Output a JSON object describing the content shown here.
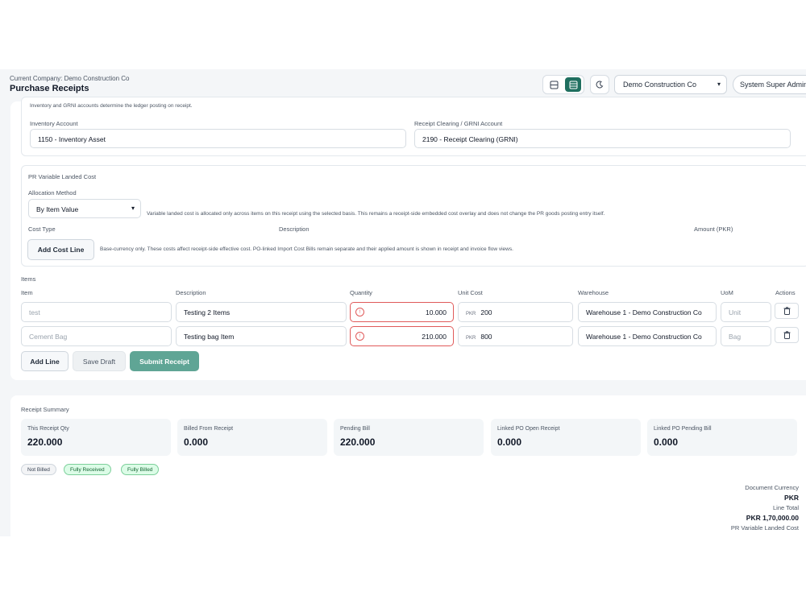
{
  "header": {
    "company_line": "Current Company: Demo Construction Co",
    "title": "Purchase Receipts",
    "company_select": "Demo Construction Co",
    "user": "System Super Admin"
  },
  "accounts": {
    "note": "Inventory and GRNI accounts determine the ledger posting on receipt.",
    "inventory_label": "Inventory Account",
    "inventory_value": "1150 - Inventory Asset",
    "grni_label": "Receipt Clearing / GRNI Account",
    "grni_value": "2190 - Receipt Clearing (GRNI)"
  },
  "landed_cost": {
    "title": "PR Variable Landed Cost",
    "allocation_label": "Allocation Method",
    "allocation_value": "By Item Value",
    "allocation_note": "Variable landed cost is allocated only across items on this receipt using the selected basis. This remains a receipt-side embedded cost overlay and does not change the PR goods posting entry itself.",
    "col_cost_type": "Cost Type",
    "col_description": "Description",
    "col_amount": "Amount (PKR)",
    "add_button": "Add Cost Line",
    "add_note": "Base-currency only. These costs affect receipt-side effective cost. PO-linked Import Cost Bills remain separate and their applied amount is shown in receipt and invoice flow views."
  },
  "items": {
    "section_label": "Items",
    "columns": {
      "item": "Item",
      "description": "Description",
      "quantity": "Quantity",
      "unit_cost": "Unit Cost",
      "warehouse": "Warehouse",
      "uom": "UoM",
      "actions": "Actions"
    },
    "currency": "PKR",
    "rows": [
      {
        "item": "test",
        "description": "Testing 2 Items",
        "quantity": "10.000",
        "unit_cost": "200",
        "warehouse": "Warehouse 1 - Demo Construction Co",
        "uom": "Unit"
      },
      {
        "item": "Cement Bag",
        "description": "Testing bag Item",
        "quantity": "210.000",
        "unit_cost": "800",
        "warehouse": "Warehouse 1 - Demo Construction Co",
        "uom": "Bag"
      }
    ],
    "add_line": "Add Line",
    "save_draft": "Save Draft",
    "submit": "Submit Receipt"
  },
  "summary": {
    "title": "Receipt Summary",
    "stats": [
      {
        "label": "This Receipt Qty",
        "value": "220.000"
      },
      {
        "label": "Billed From Receipt",
        "value": "0.000"
      },
      {
        "label": "Pending Bill",
        "value": "220.000"
      },
      {
        "label": "Linked PO Open Receipt",
        "value": "0.000"
      },
      {
        "label": "Linked PO Pending Bill",
        "value": "0.000"
      }
    ],
    "badges": [
      "Not Billed",
      "Fully Received",
      "Fully Billed"
    ],
    "doc_currency_label": "Document Currency",
    "doc_currency_value": "PKR",
    "line_total_label": "Line Total",
    "line_total_value": "PKR 1,70,000.00",
    "landed_cost_label": "PR Variable Landed Cost"
  },
  "colors": {
    "accent": "#1f6f5f",
    "primary_button": "#5fa595",
    "error": "#e05a5a",
    "badge_green": "#dcfce7"
  }
}
